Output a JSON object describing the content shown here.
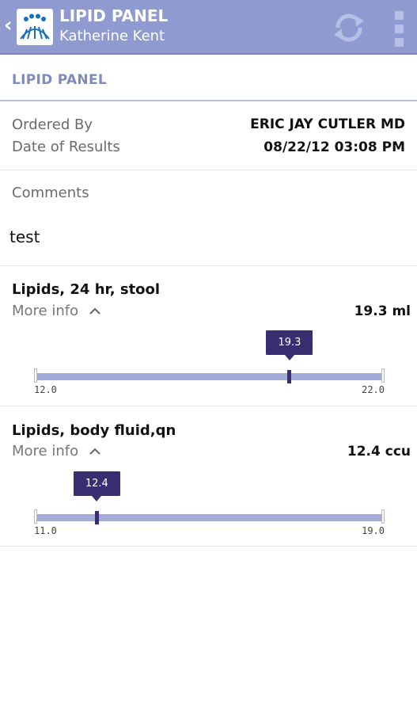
{
  "app": {
    "title": "LIPID PANEL",
    "patient_name": "Katherine Kent",
    "back_glyph": "‹",
    "icons": [
      "back-icon",
      "brand-logo-icon",
      "refresh-icon",
      "overflow-menu-icon"
    ],
    "accent": "#8e9ad0",
    "marker_color": "#3a2e72"
  },
  "section": {
    "heading": "LIPID PANEL"
  },
  "order": {
    "ordered_by_label": "Ordered By",
    "ordered_by_value": "ERIC JAY CUTLER MD",
    "date_label": "Date of Results",
    "date_value": "08/22/12 03:08 PM"
  },
  "comments": {
    "label": "Comments",
    "text": "test"
  },
  "tests": [
    {
      "name": "Lipids, 24 hr, stool",
      "more_info": "More info",
      "result": "19.3 ml",
      "value": 19.3,
      "value_label": "19.3",
      "low": 12.0,
      "high": 22.0,
      "low_label": "12.0",
      "high_label": "22.0"
    },
    {
      "name": "Lipids, body fluid,qn",
      "more_info": "More info",
      "result": "12.4 ccu",
      "value": 12.4,
      "value_label": "12.4",
      "low": 11.0,
      "high": 19.0,
      "low_label": "11.0",
      "high_label": "19.0"
    }
  ]
}
